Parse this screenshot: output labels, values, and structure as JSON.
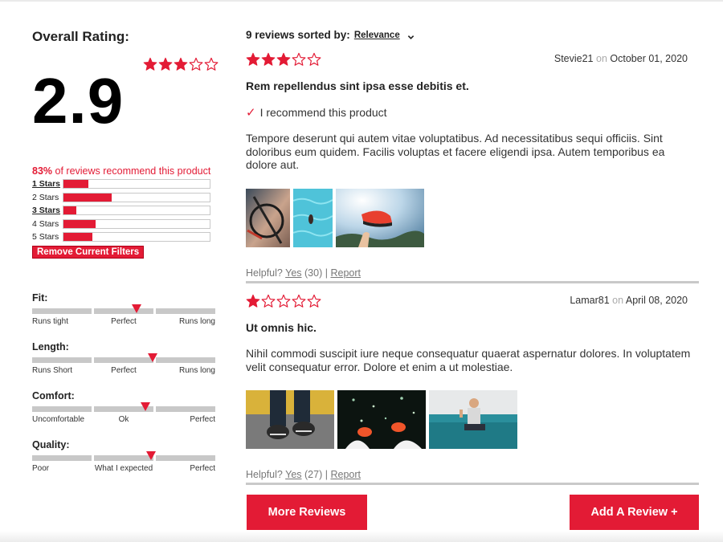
{
  "overall": {
    "title": "Overall Rating:",
    "score": "2.9",
    "stars_filled": 3,
    "stars_total": 5
  },
  "recommend": {
    "percent": "83%",
    "text": "of reviews recommend this product"
  },
  "distribution": [
    {
      "label": "1 Stars",
      "active": true,
      "fraction": 0.17
    },
    {
      "label": "2 Stars",
      "active": false,
      "fraction": 0.33
    },
    {
      "label": "3 Stars",
      "active": true,
      "fraction": 0.09
    },
    {
      "label": "4 Stars",
      "active": false,
      "fraction": 0.22
    },
    {
      "label": "5 Stars",
      "active": false,
      "fraction": 0.2
    }
  ],
  "remove_filters_label": "Remove Current Filters",
  "scales": [
    {
      "title": "Fit:",
      "left": "Runs tight",
      "middle": "Perfect",
      "right": "Runs long",
      "value": 0.57
    },
    {
      "title": "Length:",
      "left": "Runs Short",
      "middle": "Perfect",
      "right": "Runs long",
      "value": 0.66
    },
    {
      "title": "Comfort:",
      "left": "Uncomfortable",
      "middle": "Ok",
      "right": "Perfect",
      "value": 0.62
    },
    {
      "title": "Quality:",
      "left": "Poor",
      "middle": "What I expected",
      "right": "Perfect",
      "value": 0.65
    }
  ],
  "sort": {
    "label": "9 reviews sorted by:",
    "value": "Relevance"
  },
  "reviews": [
    {
      "rating": 3,
      "author": "Stevie21",
      "on": "on",
      "date": "October 01, 2020",
      "title": "Rem repellendus sint ipsa esse debitis et.",
      "recommend": "I recommend this product",
      "body": "Tempore deserunt qui autem vitae voluptatibus. Ad necessitatibus sequi officiis. Sint doloribus eum quidem. Facilis voluptas et facere eligendi ipsa. Autem temporibus ea dolore aut.",
      "helpful_label": "Helpful?",
      "yes_label": "Yes",
      "yes_count": "(30)",
      "separator": "|",
      "report_label": "Report"
    },
    {
      "rating": 1,
      "author": "Lamar81",
      "on": "on",
      "date": "April 08, 2020",
      "title": "Ut omnis hic.",
      "body": "Nihil commodi suscipit iure neque consequatur quaerat aspernatur dolores. In voluptatem velit consequatur error. Dolore et enim a ut molestiae.",
      "helpful_label": "Helpful?",
      "yes_label": "Yes",
      "yes_count": "(27)",
      "separator": "|",
      "report_label": "Report"
    }
  ],
  "buttons": {
    "more": "More Reviews",
    "add": "Add A Review +"
  },
  "colors": {
    "accent": "#e31b35",
    "track": "#c8c8c8"
  },
  "icons": {
    "star_filled": "star-filled-icon",
    "star_empty": "star-empty-icon",
    "chevron": "chevron-down-icon",
    "check": "checkmark-icon"
  }
}
